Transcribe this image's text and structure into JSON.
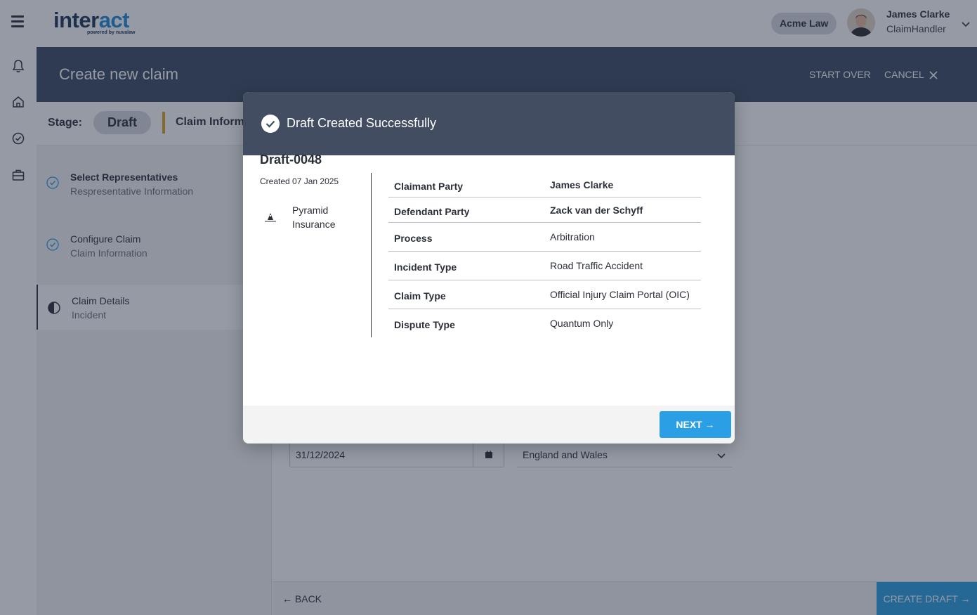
{
  "app": {
    "logo_main": "inter",
    "logo_accent": "act",
    "logo_tagline": "powered by nuvalaw",
    "org_name": "Acme Law",
    "user": {
      "name": "James Clarke",
      "role": "ClaimHandler"
    }
  },
  "header": {
    "title": "Create new claim",
    "start_over": "START OVER",
    "cancel": "CANCEL",
    "cancel_icon": "close-icon"
  },
  "stage": {
    "label": "Stage:",
    "value": "Draft",
    "section": "Claim Inform"
  },
  "steps": [
    {
      "title": "Select Representatives",
      "subtitle": "Respresentative Information",
      "status": "complete"
    },
    {
      "title": "Configure Claim",
      "subtitle": "Claim Information",
      "status": "complete"
    },
    {
      "title": "Claim Details",
      "subtitle": "Incident",
      "status": "in-progress"
    }
  ],
  "form": {
    "date_value": "31/12/2024",
    "jurisdiction_value": "England and Wales"
  },
  "footer": {
    "back": "← BACK",
    "create_draft": "CREATE DRAFT →"
  },
  "modal": {
    "title": "Draft Created Successfully",
    "draft_id": "Draft-0048",
    "created": "Created 07 Jan 2025",
    "insurer": "Pyramid Insurance",
    "rows": [
      {
        "label": "Claimant Party",
        "value": "James Clarke"
      },
      {
        "label": "Defendant Party",
        "value": "Zack van der Schyff"
      },
      {
        "label": "Process",
        "value": "Arbitration"
      },
      {
        "label": "Incident Type",
        "value": "Road Traffic Accident"
      },
      {
        "label": "Claim Type",
        "value": "Official Injury Claim Portal (OIC)"
      },
      {
        "label": "Dispute Type",
        "value": "Quantum Only"
      }
    ],
    "next": "NEXT →"
  },
  "colors": {
    "header_band": "#3d4a63",
    "modal_header": "#424d61",
    "accent_blue": "#2a9fe5",
    "stage_divider": "#d9a520"
  },
  "icons": {
    "rail": [
      "bell-icon",
      "home-icon",
      "check-circle-icon",
      "briefcase-icon"
    ],
    "step_complete": "check-circle-icon",
    "step_in_progress": "half-circle-icon",
    "calendar": "calendar-icon",
    "chevron": "chevron-down-icon"
  }
}
